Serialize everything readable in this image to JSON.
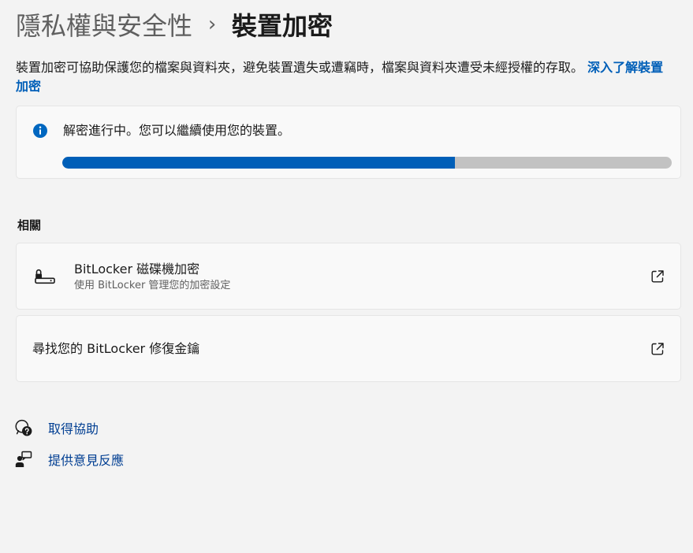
{
  "breadcrumb": {
    "parent": "隱私權與安全性",
    "separator": "›",
    "current": "裝置加密"
  },
  "description": {
    "text": "裝置加密可協助保護您的檔案與資料夾，避免裝置遺失或遭竊時，檔案與資料夾遭受未經授權的存取。",
    "link": "深入了解裝置加密"
  },
  "status": {
    "icon": "info-icon",
    "message": "解密進行中。您可以繼續使用您的裝置。",
    "progress_fraction": 0.644,
    "colors": {
      "fill": "#005fb8",
      "track": "#c2c2c2",
      "info": "#0067c0"
    }
  },
  "related": {
    "title": "相關",
    "items": [
      {
        "icon": "bitlocker-drive-icon",
        "title": "BitLocker 磁碟機加密",
        "subtitle": "使用 BitLocker 管理您的加密設定",
        "action_icon": "open-external-icon"
      },
      {
        "title": "尋找您的 BitLocker 修復金鑰",
        "action_icon": "open-external-icon"
      }
    ]
  },
  "help": {
    "items": [
      {
        "icon": "get-help-icon",
        "label": "取得協助"
      },
      {
        "icon": "feedback-icon",
        "label": "提供意見反應"
      }
    ]
  }
}
